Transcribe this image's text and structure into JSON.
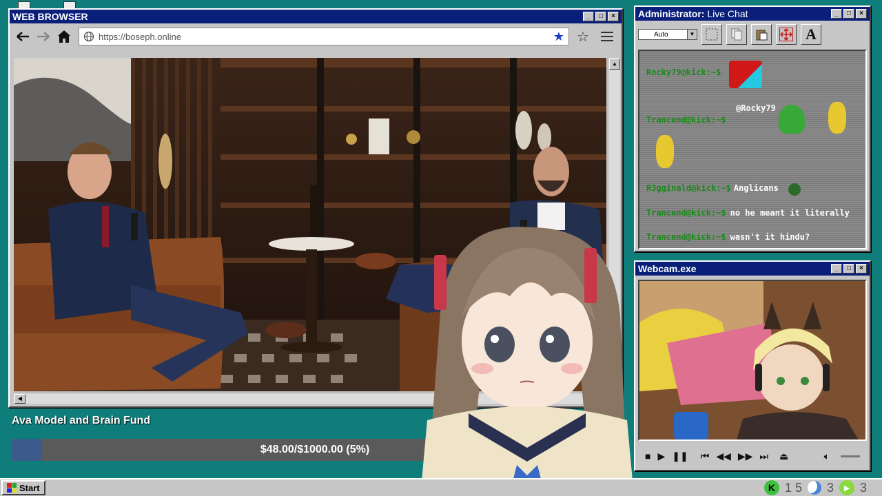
{
  "browser": {
    "title": "WEB BROWSER",
    "url": "https://boseph.online"
  },
  "chat": {
    "title_prefix": "Administrator:",
    "title_suffix": "Live Chat",
    "dropdown_value": "Auto",
    "messages": [
      {
        "user": "Rocky79@kick:~$",
        "text": ""
      },
      {
        "user": "",
        "text": "@Rocky79"
      },
      {
        "user": "Trancend@kick:~$",
        "text": ""
      },
      {
        "user": "R3gginald@kick:~$",
        "text": "Anglicans"
      },
      {
        "user": "Trancend@kick:~$",
        "text": "no he meant it literally"
      },
      {
        "user": "Trancend@kick:~$",
        "text": "wasn't it hindu?"
      }
    ]
  },
  "webcam": {
    "title": "Webcam.exe"
  },
  "fund": {
    "title": "Ava Model and Brain Fund",
    "amount_text": "$48.00/$1000.00 (5%)",
    "progress_percent": 5
  },
  "taskbar": {
    "start_label": "Start",
    "count_kick": "1 5",
    "count_moon": "3",
    "count_play": "3"
  },
  "colors": {
    "desktop": "#0f7d7a",
    "titlebar": "#0a1f7a",
    "chat_user": "#1a8a1a",
    "fund_fill": "#3d5a8c"
  },
  "icons": [
    "back-arrow-icon",
    "forward-arrow-icon",
    "home-icon",
    "globe-icon",
    "bookmark-star-icon",
    "star-outline-icon",
    "menu-icon"
  ]
}
